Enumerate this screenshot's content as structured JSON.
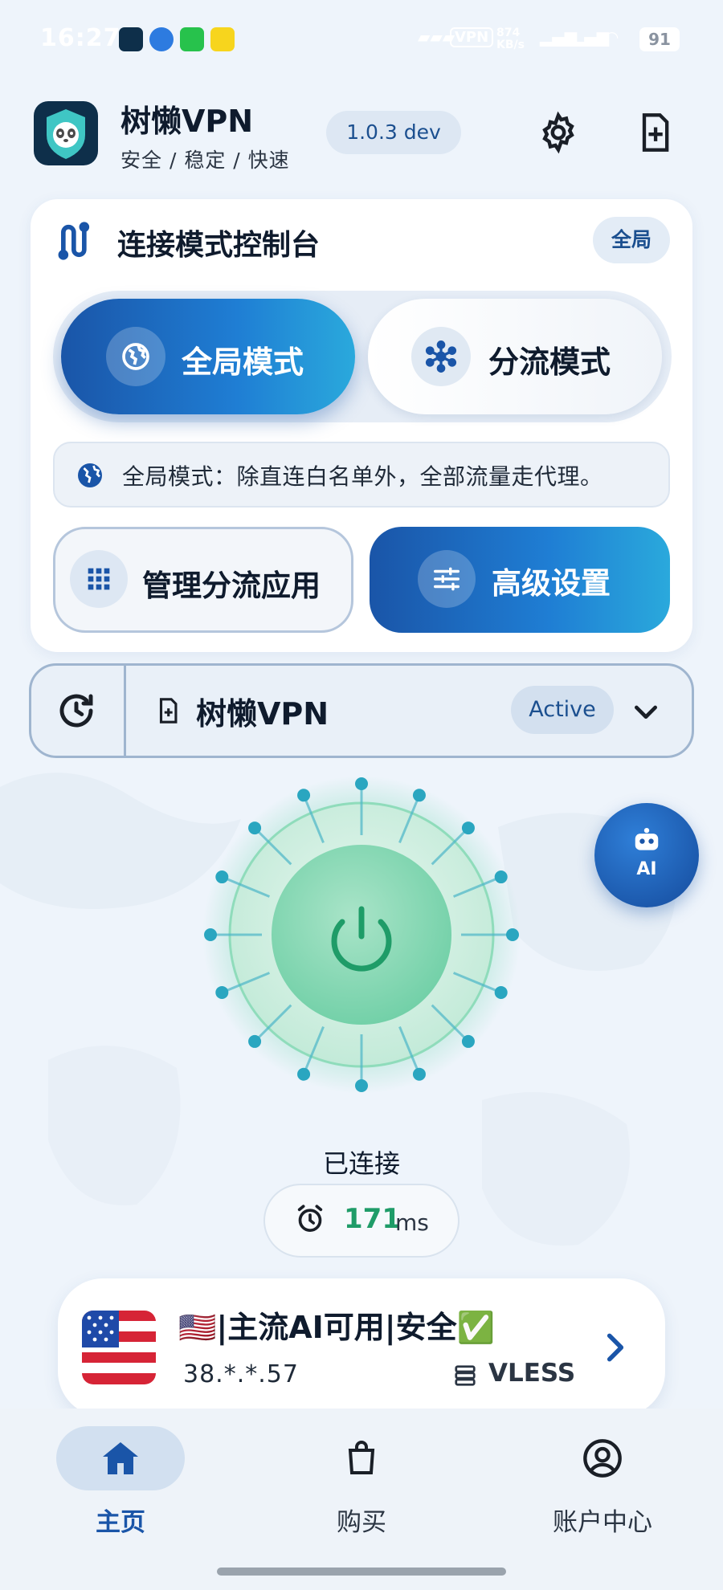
{
  "status_bar": {
    "time": "16:27",
    "signal_text": "VPN",
    "speed_text": "874 KB/s",
    "battery": "91"
  },
  "header": {
    "app_name": "树懒VPN",
    "tagline": "安全 / 稳定 / 快速",
    "version": "1.0.3 dev",
    "icons": [
      "settings-icon",
      "add-file-icon"
    ]
  },
  "console": {
    "title": "连接模式控制台",
    "badge": "全局",
    "modes": [
      {
        "label": "全局模式",
        "icon": "globe-icon",
        "selected": true
      },
      {
        "label": "分流模式",
        "icon": "hub-icon",
        "selected": false
      }
    ],
    "info": "全局模式：除直连白名单外，全部流量走代理。",
    "manage_button": "管理分流应用",
    "advanced_button": "高级设置"
  },
  "subscription": {
    "name": "树懒VPN",
    "status": "Active"
  },
  "connection": {
    "status": "已连接",
    "latency_value": "171",
    "latency_unit": "ms"
  },
  "fab": {
    "label": "AI"
  },
  "server": {
    "name": "🇺🇸|主流AI可用|安全✅",
    "ip": "38.*.*.57",
    "protocol": "VLESS"
  },
  "nav": [
    {
      "label": "主页",
      "icon": "home-icon",
      "active": true
    },
    {
      "label": "购买",
      "icon": "bag-icon",
      "active": false
    },
    {
      "label": "账户中心",
      "icon": "account-icon",
      "active": false
    }
  ],
  "colors": {
    "primary": "#1a55a8",
    "accent_gradient_end": "#2aa9dc",
    "connected_green": "#1f9c68",
    "background": "#eef4fb"
  }
}
